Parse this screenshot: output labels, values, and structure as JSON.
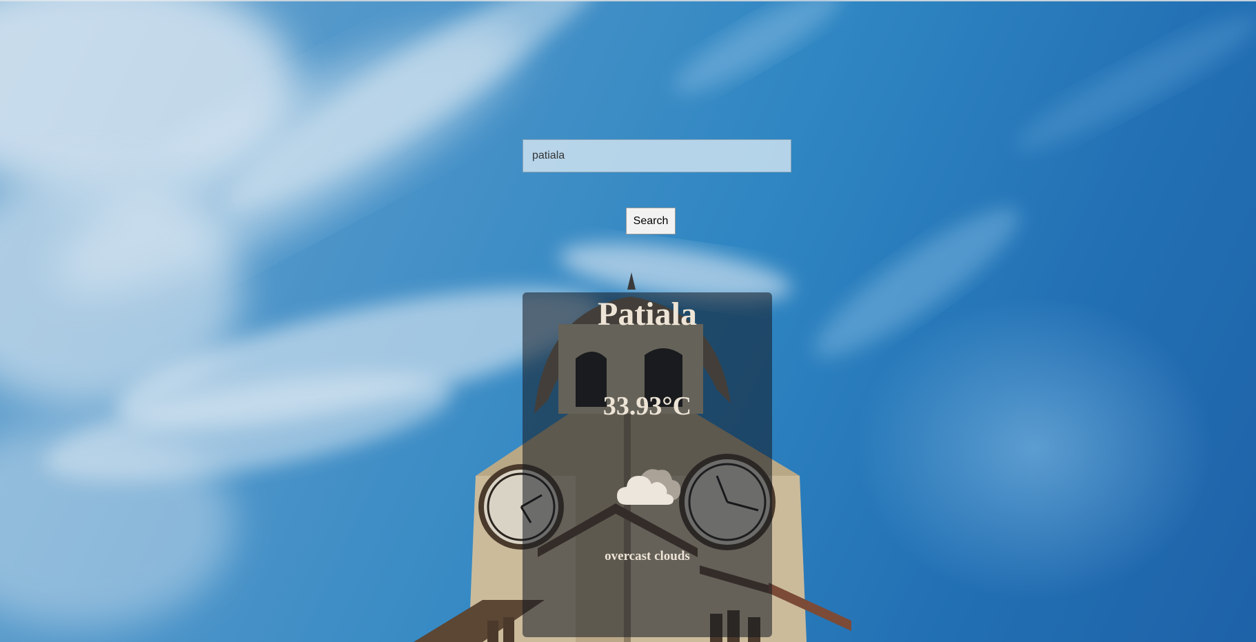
{
  "search": {
    "value": "patiala",
    "button_label": "Search"
  },
  "weather": {
    "city": "Patiala",
    "temperature": "33.93°C",
    "description": "overcast clouds",
    "icon": "cloud-icon"
  },
  "colors": {
    "sky": "#2f86c2",
    "card_overlay": "rgba(18,24,33,0.55)",
    "card_text": "#ede4d6"
  }
}
